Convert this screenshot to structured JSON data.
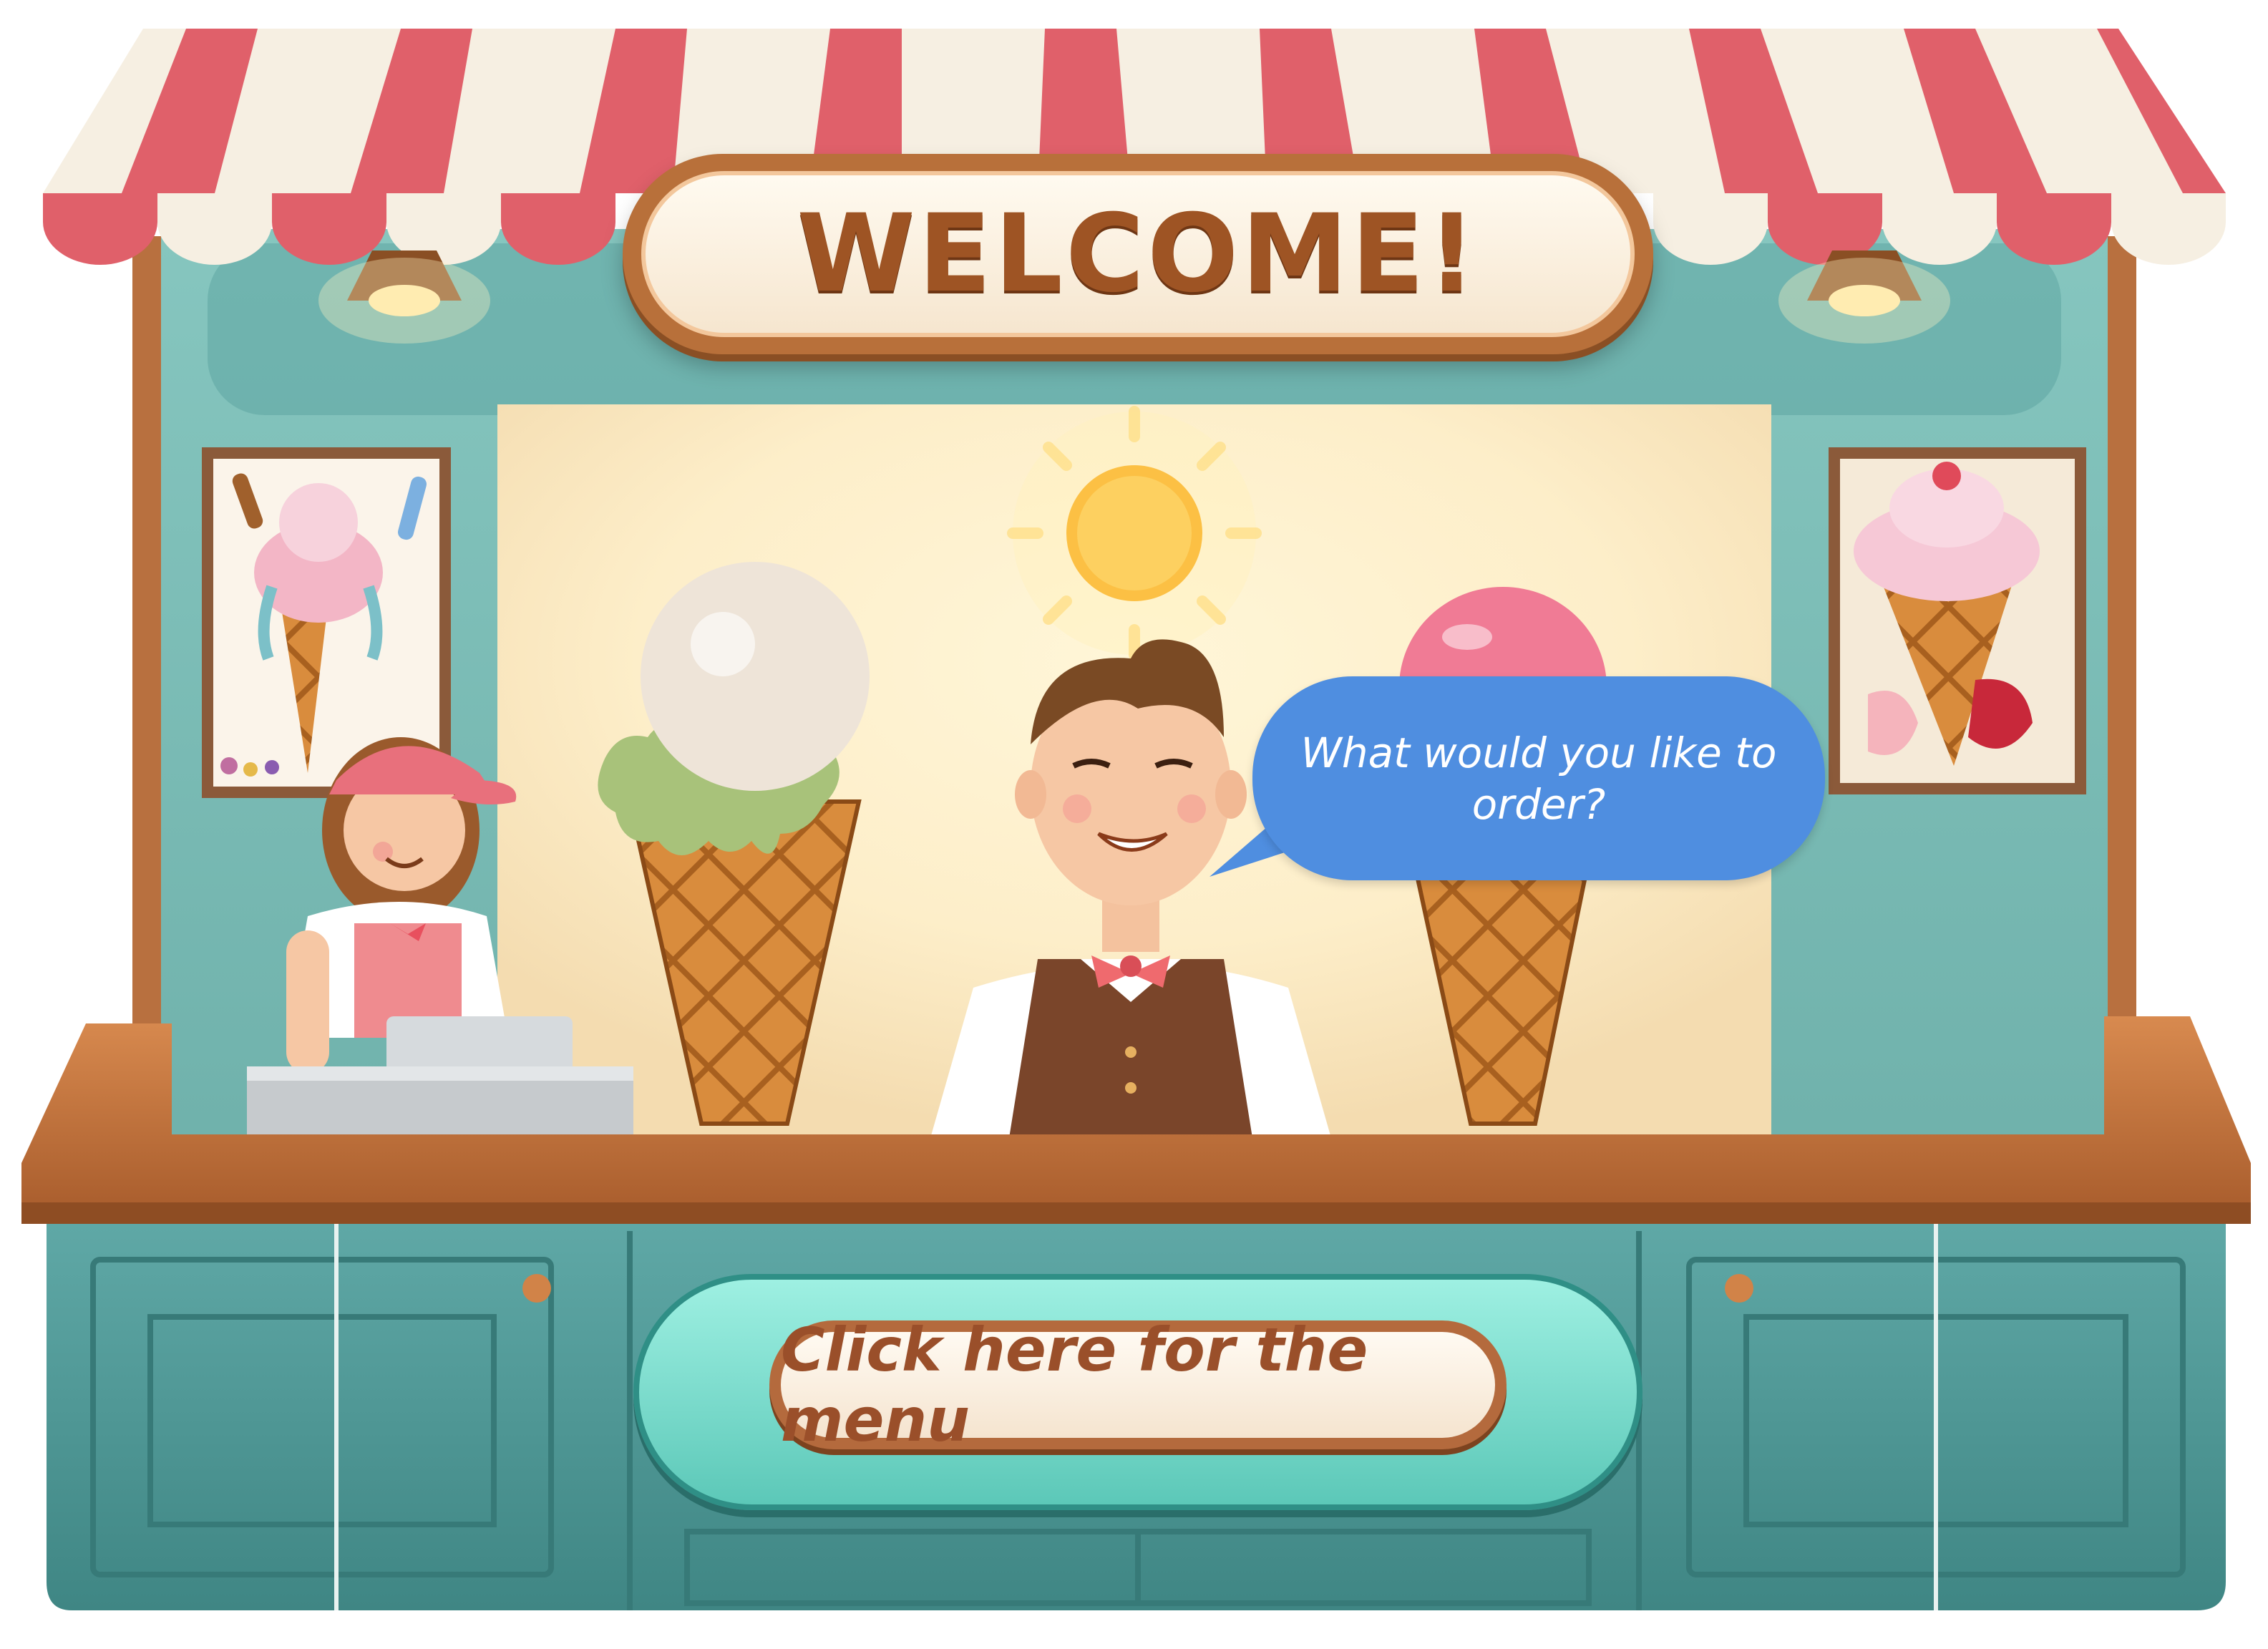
{
  "sign": {
    "title": "WELCOME!"
  },
  "speech": {
    "text": "What would you like to order?"
  },
  "menu": {
    "button_label": "Click here for the menu"
  },
  "icons": {
    "sun": "sun-icon",
    "lamps": "lamp-icon",
    "cones": "ice-cream-cone-icon",
    "posters": "ice-cream-poster"
  },
  "colors": {
    "awning_red": "#e0606a",
    "awning_cream": "#f6efe2",
    "wall_teal": "#7ebfb8",
    "counter_teal": "#4f9a98",
    "wood": "#b86d3c",
    "bubble_blue": "#4f8ee0",
    "sign_text": "#9e5424",
    "menu_teal": "#7fe0d2"
  }
}
